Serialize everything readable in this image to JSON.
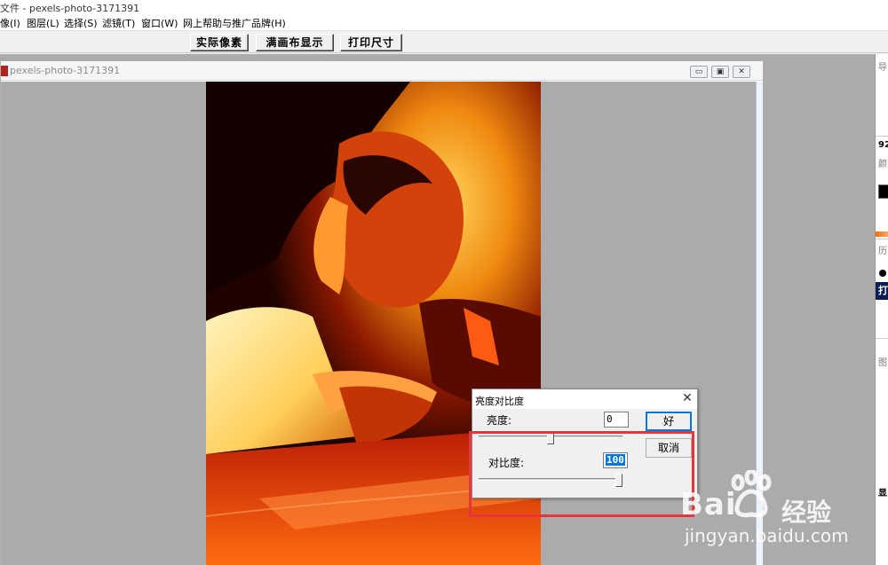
{
  "app": {
    "title": "文件 - pexels-photo-3171391"
  },
  "menu": [
    "像(I)",
    "图层(L)",
    "选择(S)",
    "滤镜(T)",
    "窗口(W)",
    "网上帮助与推广品牌(H)"
  ],
  "toolbar": {
    "actual_pixels": "实际像素",
    "fit_canvas": "满画布显示",
    "print_size": "打印尺寸"
  },
  "document": {
    "title": "pexels-photo-3171391",
    "minimize": "▭",
    "restore": "▣",
    "close": "✕"
  },
  "right_panel": {
    "nav_label": "导",
    "zoom": "92",
    "color_label": "颜",
    "history_label": "历",
    "history_item": "打",
    "layers_label": "图",
    "bottom_label": "显"
  },
  "dialog": {
    "title": "亮度对比度",
    "close": "✕",
    "brightness_label": "亮度:",
    "brightness_value": "0",
    "brightness_level": 0.5,
    "contrast_label": "对比度:",
    "contrast_value": "100",
    "contrast_level": 1.0,
    "ok": "好",
    "cancel": "取消"
  },
  "watermark": {
    "brand": "Bai",
    "brand_cn": "经验",
    "url": "jingyan.baidu.com"
  },
  "colors": {
    "annotation": "#e8353c",
    "selection": "#0078d7"
  }
}
